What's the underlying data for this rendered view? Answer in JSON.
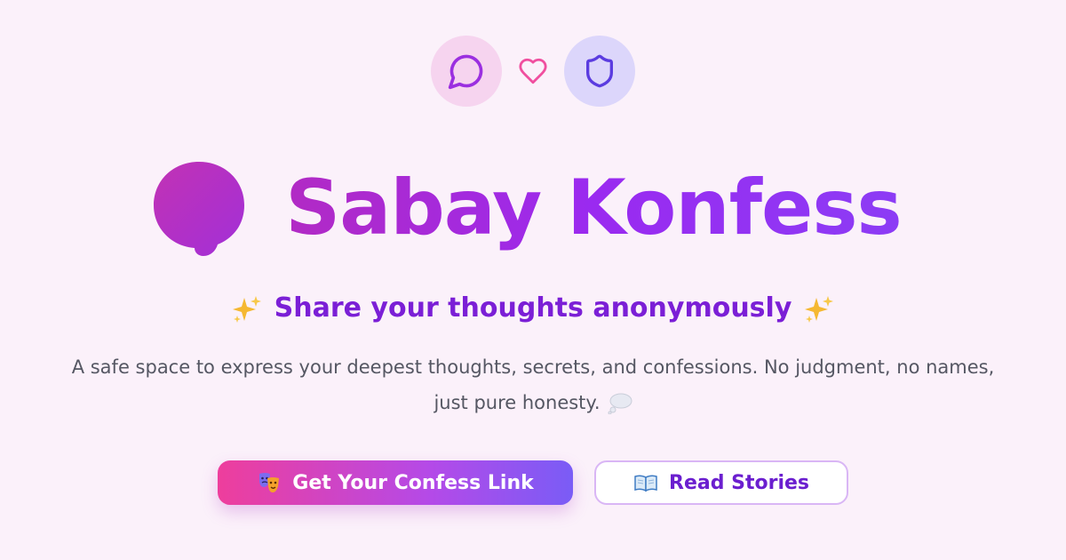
{
  "header_icons": {
    "left": "message-circle-icon",
    "middle": "heart-icon",
    "right": "shield-icon"
  },
  "hero": {
    "logo_icon": "speech-bubble-icon",
    "title": "Sabay Konfess",
    "tagline_prefix_icon": "sparkles-icon",
    "tagline": "Share your thoughts anonymously",
    "tagline_suffix_icon": "sparkles-icon",
    "description": "A safe space to express your deepest thoughts, secrets, and confessions. No judgment, no names, just pure honesty.",
    "description_icon": "thought-balloon-icon"
  },
  "actions": {
    "primary": {
      "icon": "performing-arts-icon",
      "label": "Get Your Confess Link"
    },
    "secondary": {
      "icon": "open-book-icon",
      "label": "Read Stories"
    }
  },
  "colors": {
    "background": "#fbf1fa",
    "accent_purple": "#8c3cf5",
    "accent_pink": "#ee3e9c",
    "tagline": "#7b1fd6",
    "body_text": "#555763"
  }
}
